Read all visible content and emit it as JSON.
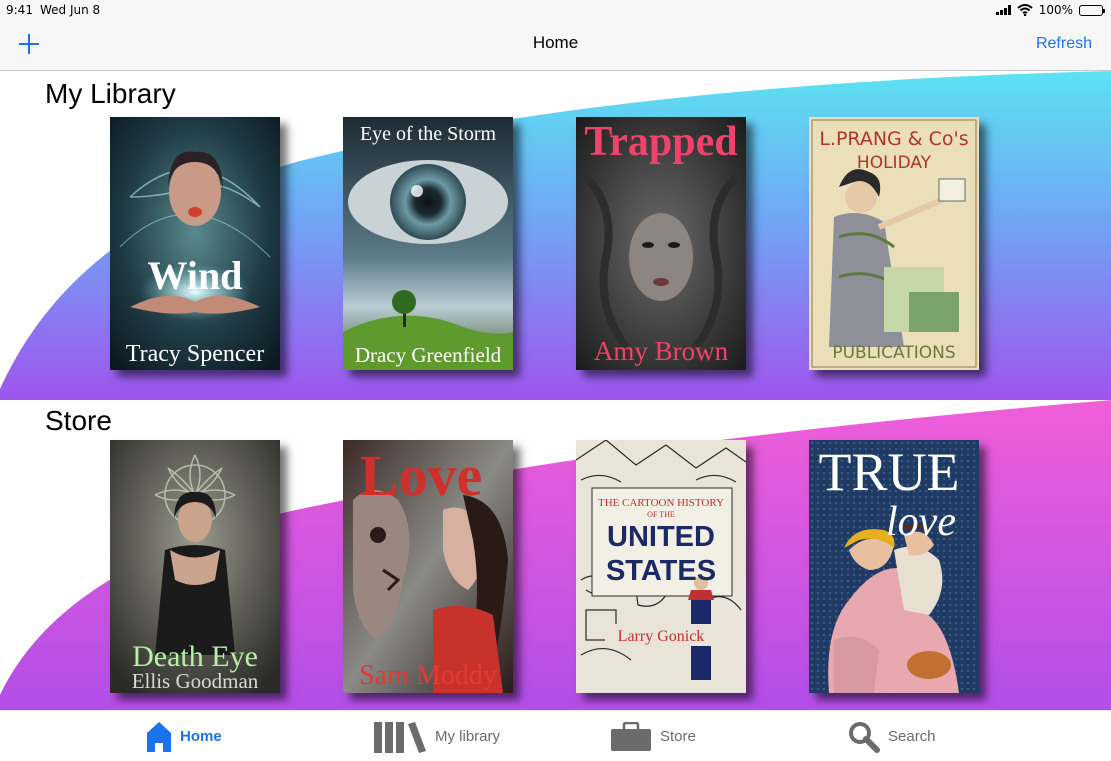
{
  "status": {
    "time": "9:41",
    "date": "Wed Jun 8",
    "battery": "100%",
    "battery_level": 1.0
  },
  "nav": {
    "title": "Home",
    "refresh_label": "Refresh"
  },
  "colors": {
    "accent": "#1a73e8",
    "library_gradient": [
      "#5ce3f2",
      "#9f55ee"
    ],
    "store_gradient": [
      "#f05ed8",
      "#b24ee8"
    ]
  },
  "library": {
    "title": "My Library",
    "books": [
      {
        "title": "Wind",
        "author": "Tracy Spencer"
      },
      {
        "title": "Eye of the Storm",
        "author": "Dracy Greenfield"
      },
      {
        "title": "Trapped",
        "author": "Amy Brown"
      },
      {
        "title_line1": "L.PRANG & Co's",
        "title_line2": "HOLIDAY",
        "subtitle": "PUBLICATIONS"
      }
    ]
  },
  "store": {
    "title": "Store",
    "books": [
      {
        "title": "Death Eye",
        "author": "Ellis Goodman"
      },
      {
        "title": "Love",
        "author": "Sam Moddy"
      },
      {
        "line1": "THE CARTOON HISTORY",
        "line2": "OF THE",
        "line3": "UNITED",
        "line4": "STATES",
        "author": "Larry Gonick"
      },
      {
        "title_line1": "TRUE",
        "title_line2": "love"
      }
    ]
  },
  "tabs": [
    {
      "label": "Home",
      "icon": "home-icon",
      "active": true
    },
    {
      "label": "My library",
      "icon": "books-icon",
      "active": false
    },
    {
      "label": "Store",
      "icon": "bag-icon",
      "active": false
    },
    {
      "label": "Search",
      "icon": "search-icon",
      "active": false
    }
  ]
}
